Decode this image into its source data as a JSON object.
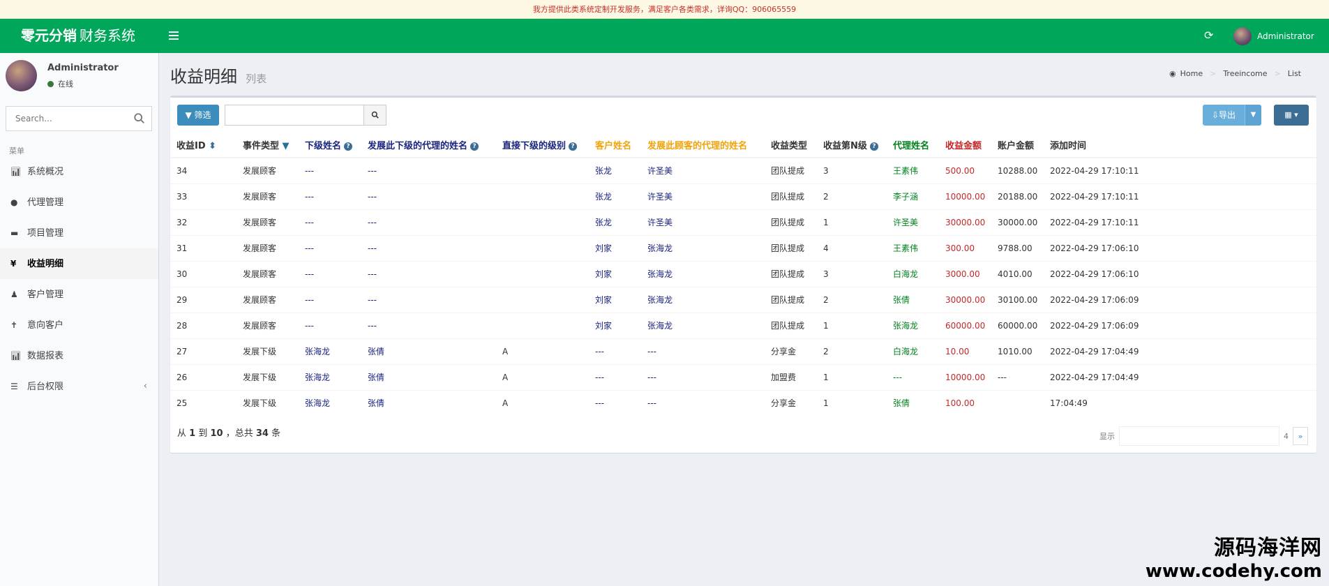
{
  "notice": "我方提供此类系统定制开发服务，满足客户各类需求，详询QQ：906065559",
  "topbar": {
    "brand_bold": "零元分销",
    "brand_rest": "财务系统",
    "user_name": "Administrator"
  },
  "sidebar": {
    "user_name": "Administrator",
    "status": "在线",
    "search_placeholder": "Search...",
    "menu_header": "菜单",
    "items": [
      {
        "label": "系统概况",
        "icon": "bar-chart-icon"
      },
      {
        "label": "代理管理",
        "icon": "user-icon"
      },
      {
        "label": "项目管理",
        "icon": "credit-card-icon"
      },
      {
        "label": "收益明细",
        "icon": "yen-icon",
        "active": true
      },
      {
        "label": "客户管理",
        "icon": "user-tie-icon"
      },
      {
        "label": "意向客户",
        "icon": "person-icon"
      },
      {
        "label": "数据报表",
        "icon": "bar-chart-icon"
      },
      {
        "label": "后台权限",
        "icon": "list-icon"
      }
    ]
  },
  "page": {
    "title": "收益明细",
    "subtitle": "列表",
    "breadcrumb": [
      "Home",
      "Treeincome",
      "List"
    ]
  },
  "toolbar": {
    "filter_label": "筛选",
    "export_label": "导出"
  },
  "table": {
    "columns": [
      "收益ID",
      "事件类型",
      "下级姓名",
      "发展此下级的代理的姓名",
      "直接下级的级别",
      "客户姓名",
      "发展此顾客的代理的姓名",
      "收益类型",
      "收益第N级",
      "代理姓名",
      "收益金额",
      "账户金额",
      "添加时间"
    ],
    "rows": [
      [
        "34",
        "发展顾客",
        "---",
        "---",
        "",
        "张龙",
        "许圣美",
        "团队提成",
        "3",
        "王素伟",
        "500.00",
        "10288.00",
        "2022-04-29 17:10:11"
      ],
      [
        "33",
        "发展顾客",
        "---",
        "---",
        "",
        "张龙",
        "许圣美",
        "团队提成",
        "2",
        "李子涵",
        "10000.00",
        "20188.00",
        "2022-04-29 17:10:11"
      ],
      [
        "32",
        "发展顾客",
        "---",
        "---",
        "",
        "张龙",
        "许圣美",
        "团队提成",
        "1",
        "许圣美",
        "30000.00",
        "30000.00",
        "2022-04-29 17:10:11"
      ],
      [
        "31",
        "发展顾客",
        "---",
        "---",
        "",
        "刘家",
        "张海龙",
        "团队提成",
        "4",
        "王素伟",
        "300.00",
        "9788.00",
        "2022-04-29 17:06:10"
      ],
      [
        "30",
        "发展顾客",
        "---",
        "---",
        "",
        "刘家",
        "张海龙",
        "团队提成",
        "3",
        "白海龙",
        "3000.00",
        "4010.00",
        "2022-04-29 17:06:10"
      ],
      [
        "29",
        "发展顾客",
        "---",
        "---",
        "",
        "刘家",
        "张海龙",
        "团队提成",
        "2",
        "张倩",
        "30000.00",
        "30100.00",
        "2022-04-29 17:06:09"
      ],
      [
        "28",
        "发展顾客",
        "---",
        "---",
        "",
        "刘家",
        "张海龙",
        "团队提成",
        "1",
        "张海龙",
        "60000.00",
        "60000.00",
        "2022-04-29 17:06:09"
      ],
      [
        "27",
        "发展下级",
        "张海龙",
        "张倩",
        "A",
        "---",
        "---",
        "分享金",
        "2",
        "白海龙",
        "10.00",
        "1010.00",
        "2022-04-29 17:04:49"
      ],
      [
        "26",
        "发展下级",
        "张海龙",
        "张倩",
        "A",
        "---",
        "---",
        "加盟费",
        "1",
        "---",
        "10000.00",
        "---",
        "2022-04-29 17:04:49"
      ],
      [
        "25",
        "发展下级",
        "张海龙",
        "张倩",
        "A",
        "---",
        "---",
        "分享金",
        "1",
        "张倩",
        "100.00",
        "",
        "17:04:49"
      ]
    ]
  },
  "footer": {
    "pre": "从",
    "from": "1",
    "mid1": "到",
    "to": "10",
    "mid2": "，总共",
    "total": "34",
    "post": "条"
  },
  "pager": {
    "display_label": "显示",
    "page_num": "4",
    "next": "»"
  },
  "watermark": {
    "line1": "源码海洋网",
    "line2": "www.codehy.com"
  }
}
